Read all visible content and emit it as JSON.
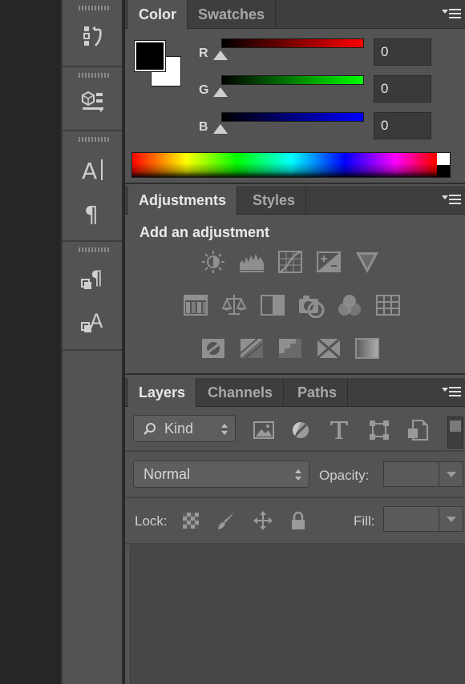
{
  "color_panel": {
    "tabs": [
      {
        "label": "Color"
      },
      {
        "label": "Swatches"
      }
    ],
    "channels": [
      {
        "label": "R",
        "value": "0",
        "gradient_from": "#000000",
        "gradient_to": "#ff0000"
      },
      {
        "label": "G",
        "value": "0",
        "gradient_from": "#000000",
        "gradient_to": "#00ff00"
      },
      {
        "label": "B",
        "value": "0",
        "gradient_from": "#000000",
        "gradient_to": "#0000ff"
      }
    ],
    "foreground_color": "#000000",
    "background_color": "#ffffff"
  },
  "adjustments_panel": {
    "tabs": [
      {
        "label": "Adjustments"
      },
      {
        "label": "Styles"
      }
    ],
    "heading": "Add an adjustment",
    "icons": [
      "brightness-contrast-icon",
      "levels-icon",
      "curves-icon",
      "exposure-icon",
      "vibrance-icon",
      "hue-saturation-icon",
      "color-balance-icon",
      "black-white-icon",
      "photo-filter-icon",
      "channel-mixer-icon",
      "color-lookup-icon",
      "invert-icon",
      "posterize-icon",
      "threshold-icon",
      "selective-color-icon",
      "gradient-map-icon"
    ]
  },
  "layers_panel": {
    "tabs": [
      {
        "label": "Layers"
      },
      {
        "label": "Channels"
      },
      {
        "label": "Paths"
      }
    ],
    "filter_kind": "Kind",
    "blend_mode": "Normal",
    "opacity_label": "Opacity:",
    "lock_label": "Lock:",
    "fill_label": "Fill:"
  },
  "toolstrip": {
    "groups": [
      {
        "tools": [
          "history-icon"
        ]
      },
      {
        "tools": [
          "3d-icon"
        ]
      },
      {
        "tools": [
          "character-icon",
          "paragraph-icon"
        ]
      },
      {
        "tools": [
          "paragraph-styles-icon",
          "character-styles-icon"
        ]
      }
    ]
  }
}
